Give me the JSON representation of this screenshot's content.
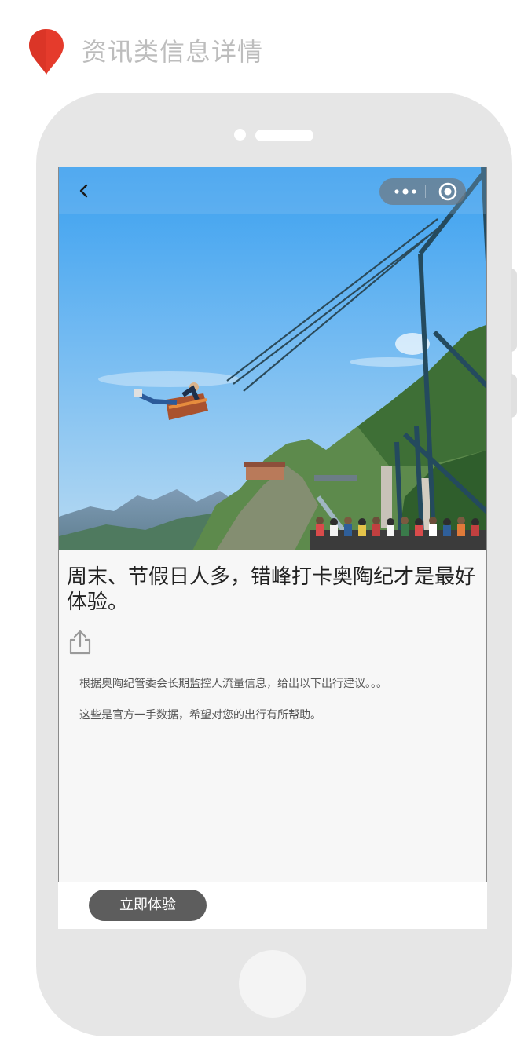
{
  "header": {
    "title": "资讯类信息详情",
    "pin_color": "#e53b2c",
    "pin_icon": "location-pin-icon"
  },
  "navbar": {
    "back_icon": "chevron-left-icon",
    "capsule": {
      "more_icon": "more-dots-icon",
      "close_icon": "target-circle-icon"
    }
  },
  "article": {
    "hero_image": "swing-over-mountain-cliff-photo",
    "title": "周末、节假日人多，错峰打卡奥陶纪才是最好体验。",
    "share_icon": "share-upload-icon",
    "paragraphs": [
      "根据奥陶纪管委会长期监控人流量信息，给出以下出行建议。。。",
      "这些是官方一手数据，希望对您的出行有所帮助。"
    ]
  },
  "footer": {
    "cta_label": "立即体验",
    "cta_color": "#5d5d5d"
  }
}
